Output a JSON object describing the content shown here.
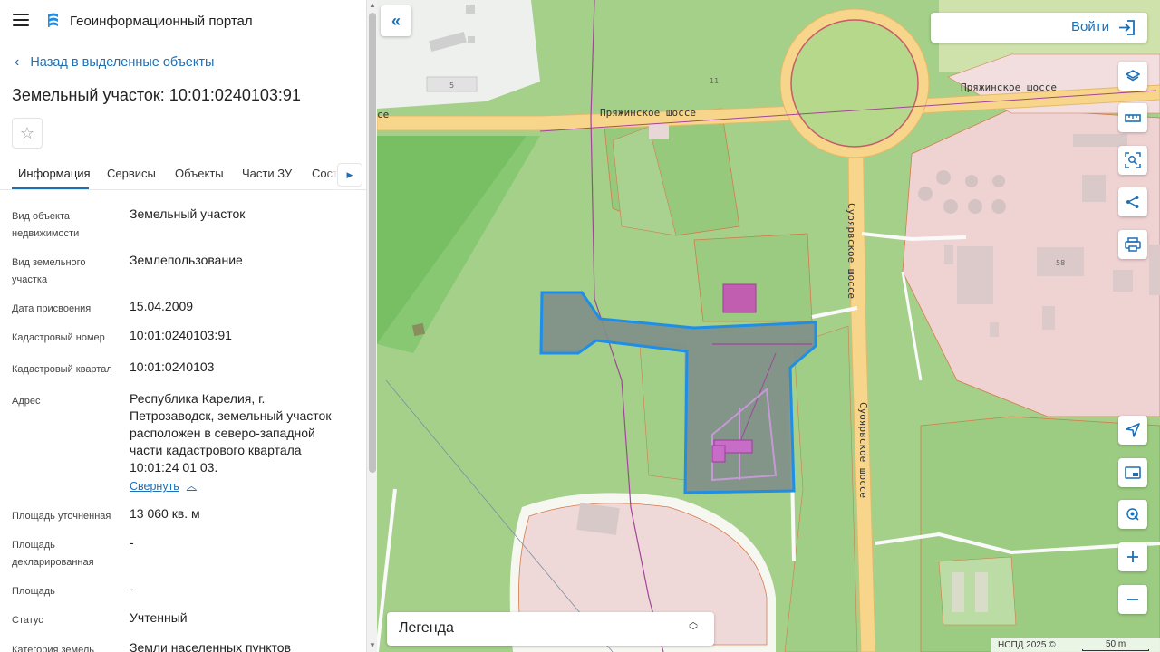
{
  "app": {
    "title": "Геоинформационный портал"
  },
  "nav": {
    "back_label": "Назад в выделенные объекты"
  },
  "object": {
    "title": "Земельный участок: 10:01:0240103:91"
  },
  "tabs": [
    {
      "label": "Информация"
    },
    {
      "label": "Сервисы"
    },
    {
      "label": "Объекты"
    },
    {
      "label": "Части ЗУ"
    },
    {
      "label": "Соста"
    }
  ],
  "details": [
    {
      "label": "Вид объекта недвижимости",
      "value": "Земельный участок"
    },
    {
      "label": "Вид земельного участка",
      "value": "Землепользование"
    },
    {
      "label": "Дата присвоения",
      "value": "15.04.2009"
    },
    {
      "label": "Кадастровый номер",
      "value": "10:01:0240103:91"
    },
    {
      "label": "Кадастровый квартал",
      "value": "10:01:0240103"
    },
    {
      "label": "Адрес",
      "value": "Республика Карелия, г. Петрозаводск, земельный участок расположен в северо-западной части кадастрового квартала 10:01:24 01 03."
    },
    {
      "label": "Площадь уточненная",
      "value": "13 060 кв. м"
    },
    {
      "label": "Площадь декларированная",
      "value": "-"
    },
    {
      "label": "Площадь",
      "value": "-"
    },
    {
      "label": "Статус",
      "value": "Учтенный"
    },
    {
      "label": "Категория земель",
      "value": "Земли населенных пунктов"
    }
  ],
  "address_toggle": "Свернуть",
  "map": {
    "login_label": "Войти",
    "legend_label": "Легенда",
    "attribution": "НСПД 2025 ©",
    "scale_label": "50 m",
    "street_1": "Пряжинское шоссе",
    "street_2": "Пряжинское шоссе",
    "street_3": "Суоярвское шоссе",
    "street_4": "Суоярвское шоссе",
    "house_5": "5",
    "house_11": "11",
    "house_58": "58",
    "edge_label": "се"
  },
  "colors": {
    "accent": "#1f6fb5",
    "parcel_fill": "#7f8f88",
    "parcel_stroke": "#1e8ee6",
    "road": "#f7d58a",
    "grass": "#9dcc7f"
  },
  "tools": [
    "layers-icon",
    "ruler-icon",
    "area-search-icon",
    "share-icon",
    "print-icon",
    "locate-icon",
    "minimap-icon",
    "geolocation-icon",
    "zoom-in-icon",
    "zoom-out-icon"
  ]
}
